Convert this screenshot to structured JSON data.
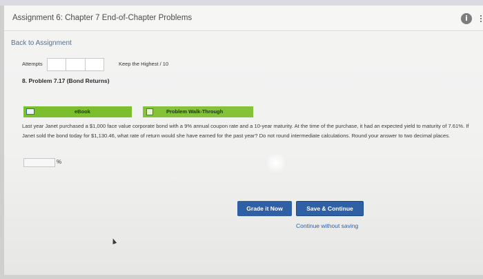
{
  "header": {
    "title": "Assignment 6: Chapter 7 End-of-Chapter Problems",
    "info_icon_glyph": "i"
  },
  "nav": {
    "back_link": "Back to Assignment"
  },
  "attempts": {
    "label": "Attempts",
    "keep_highest": "Keep the Highest",
    "max_score": "/ 10"
  },
  "problem": {
    "title": "8. Problem 7.17 (Bond Returns)",
    "ebook_label": "eBook",
    "walkthrough_label": "Problem Walk-Through",
    "question": "Last year Janet purchased a $1,000 face value corporate bond with a 9% annual coupon rate and a 10-year maturity. At the time of the purchase, it had an expected yield to maturity of 7.61%. If Janet sold the bond today for $1,130.46, what rate of return would she have earned for the past year? Do not round intermediate calculations. Round your answer to two decimal places.",
    "answer_value": "",
    "answer_unit": "%"
  },
  "actions": {
    "grade_label": "Grade it Now",
    "save_label": "Save & Continue",
    "continue_label": "Continue without saving"
  },
  "colors": {
    "primary_button": "#2f5fa5",
    "ebook_green": "#7bbf2e",
    "walkthrough_green": "#84c23a"
  }
}
